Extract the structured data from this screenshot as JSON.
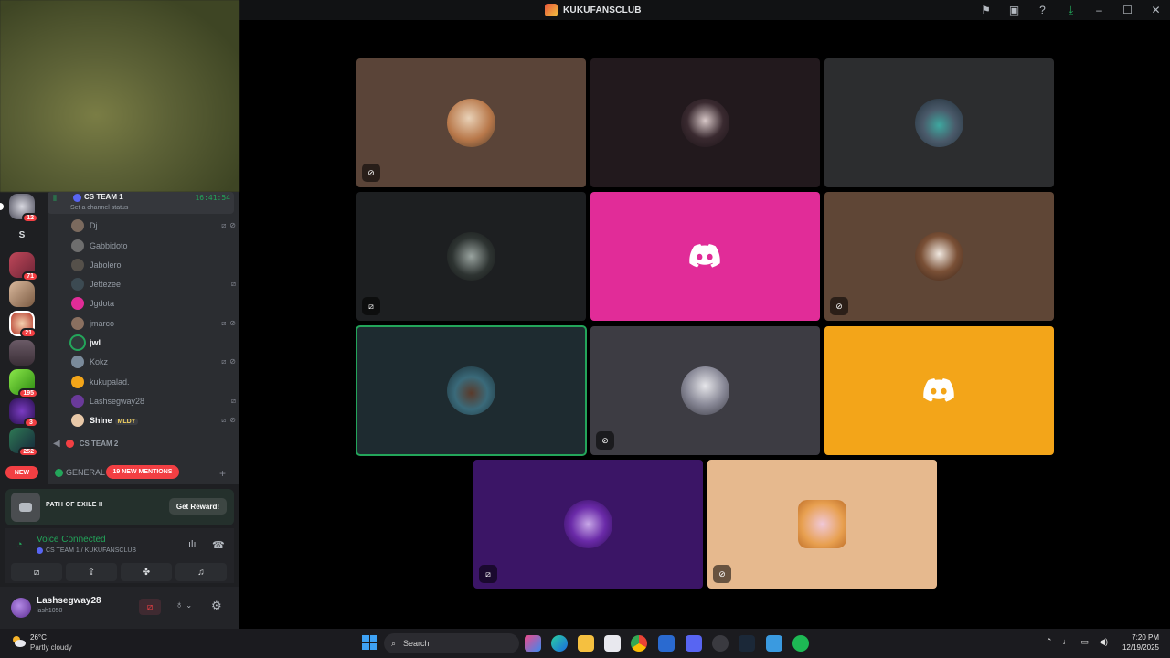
{
  "window": {
    "title": "KUKUFANSCLUB"
  },
  "guild_badges": [
    "12",
    "71",
    "21",
    "195",
    "3",
    "252"
  ],
  "guild_letter": "S",
  "voice_channel": {
    "name": "CS TEAM 1",
    "time": "16:41:54",
    "status_placeholder": "Set a channel status"
  },
  "members": [
    {
      "name": "Dj"
    },
    {
      "name": "Gabbidoto"
    },
    {
      "name": "Jabolero"
    },
    {
      "name": "Jettezee"
    },
    {
      "name": "Jgdota"
    },
    {
      "name": "jmarco"
    },
    {
      "name": "jwl"
    },
    {
      "name": "Kokz"
    },
    {
      "name": "kukupalad."
    },
    {
      "name": "Lashsegway28"
    },
    {
      "name": "Shine",
      "tag": "MLDY"
    }
  ],
  "second_channel": {
    "name": "CS TEAM 2"
  },
  "new_label": "NEW",
  "general": {
    "name": "GENERAL",
    "mentions": "19 NEW MENTIONS"
  },
  "promo": {
    "title": "PATH OF EXILE II",
    "button": "Get Reward!"
  },
  "voice_status": {
    "title": "Voice Connected",
    "subtitle": "CS TEAM 1 / KUKUFANSCLUB"
  },
  "user": {
    "display_name": "Lashsegway28",
    "username": "lash1050"
  },
  "taskbar": {
    "temperature": "26°C",
    "weather": "Partly cloudy",
    "search_placeholder": "Search",
    "time": "7:20 PM",
    "date": "12/19/2025"
  },
  "colors": {
    "accent_green": "#23a55a",
    "danger_red": "#f23f43",
    "blurple": "#5865f2",
    "tile_pink": "#e12c98",
    "tile_orange": "#f3a519",
    "tile_purple": "#3b1566",
    "tile_peach": "#e6b98e"
  }
}
